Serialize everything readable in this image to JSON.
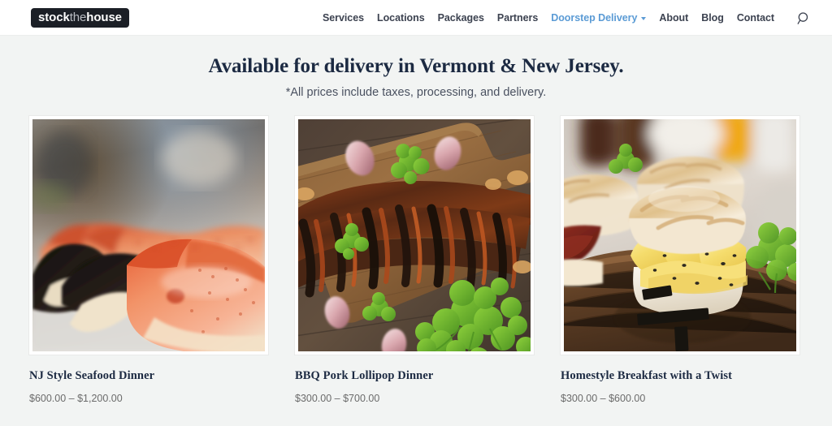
{
  "header": {
    "logo": {
      "part1": "stock",
      "part2": "the",
      "part3": "house"
    },
    "nav": [
      {
        "label": "Services",
        "active": false
      },
      {
        "label": "Locations",
        "active": false
      },
      {
        "label": "Packages",
        "active": false
      },
      {
        "label": "Partners",
        "active": false
      },
      {
        "label": "Doorstep Delivery",
        "active": true
      },
      {
        "label": "About",
        "active": false
      },
      {
        "label": "Blog",
        "active": false
      },
      {
        "label": "Contact",
        "active": false
      }
    ],
    "search_icon": "search-icon",
    "dropdown_icon": "chevron-down-icon"
  },
  "main": {
    "title": "Available for delivery in Vermont & New Jersey.",
    "subtitle": "*All prices include taxes, processing, and delivery.",
    "products": [
      {
        "title": "NJ Style Seafood Dinner",
        "price": "$600.00 – $1,200.00",
        "image_alt": "stone-crab-claws-photo"
      },
      {
        "title": "BBQ Pork Lollipop Dinner",
        "price": "$300.00 – $700.00",
        "image_alt": "bbq-pork-ribs-on-cutting-board-photo"
      },
      {
        "title": "Homestyle Breakfast with a Twist",
        "price": "$300.00 – $600.00",
        "image_alt": "biscuit-egg-bacon-sandwiches-photo"
      }
    ]
  },
  "colors": {
    "accent_blue": "#5b9bd5",
    "heading_navy": "#1c2a42",
    "page_background": "#f2f4f3",
    "header_background": "#ffffff",
    "logo_background": "#1b1f26",
    "price_gray": "#6b6b6b"
  }
}
